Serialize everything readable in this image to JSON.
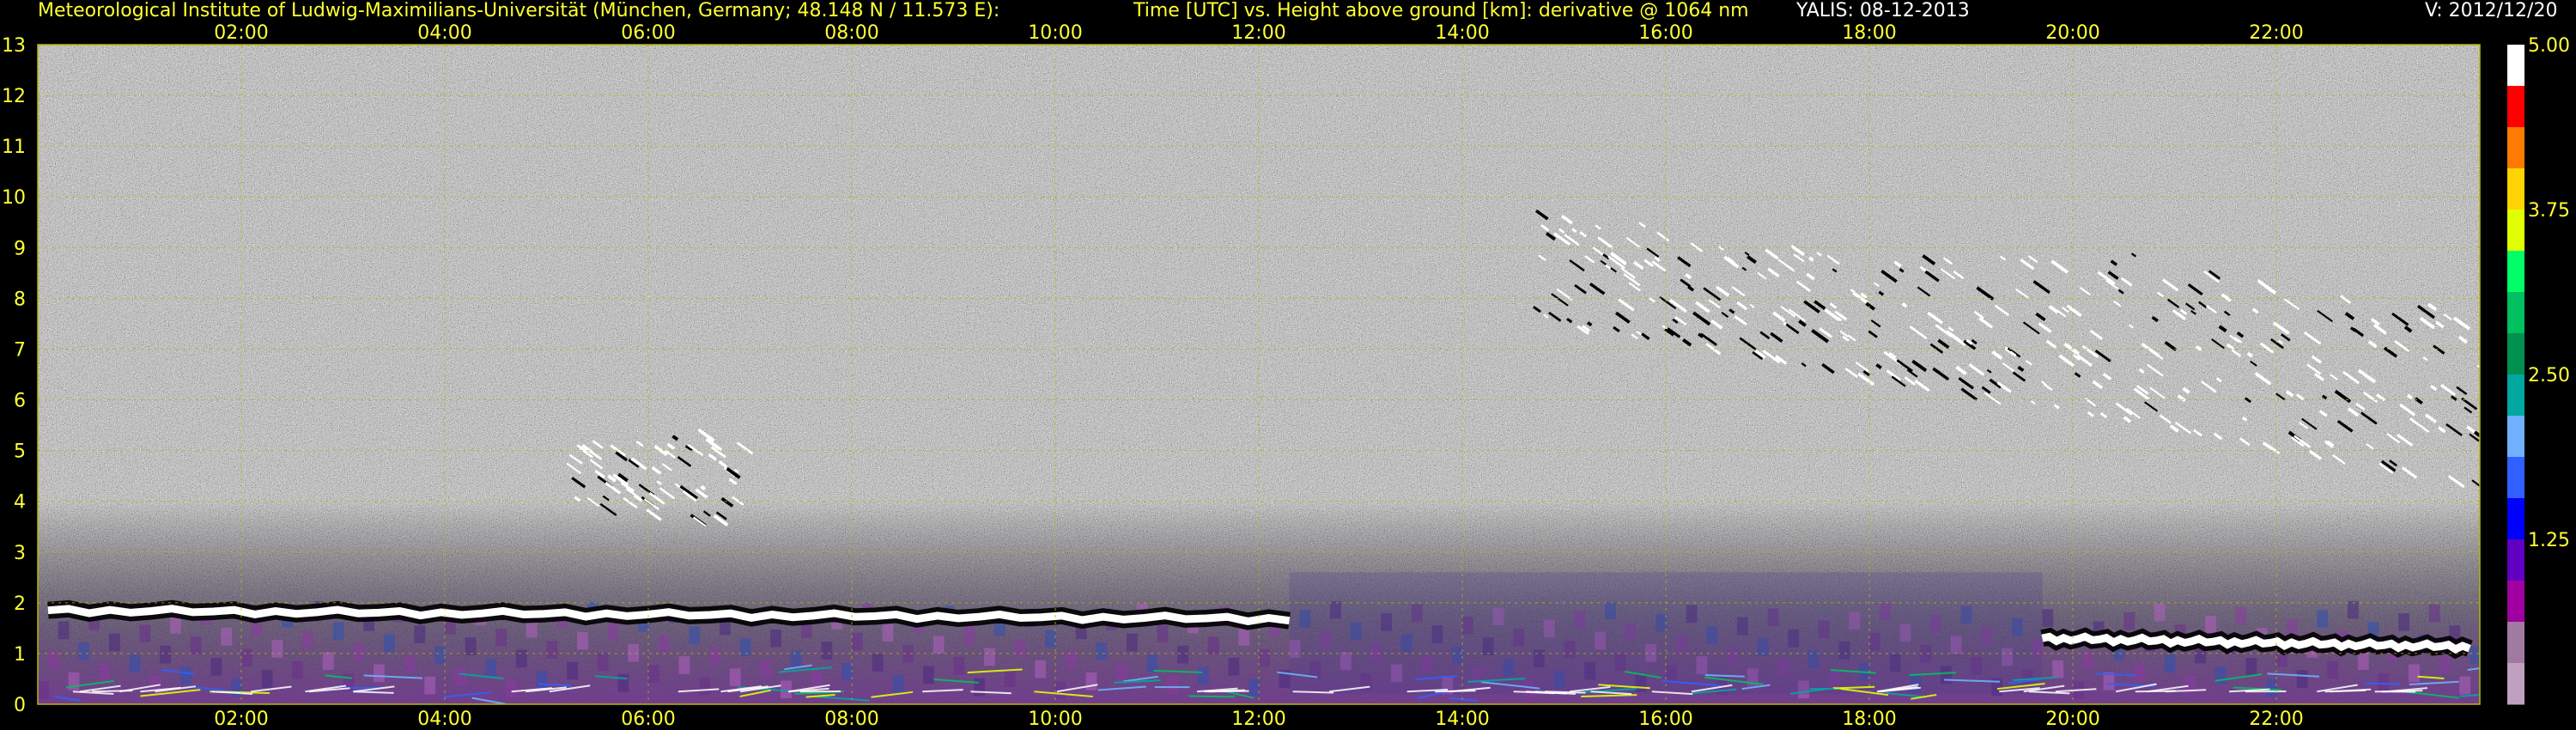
{
  "header": {
    "institute": "Meteorological Institute of Ludwig-Maximilians-Universität (München, Germany; 48.148 N / 11.573 E):",
    "description": "Time [UTC] vs. Height above ground [km]: derivative @ 1064 nm",
    "station_date": "YALIS: 08-12-2013",
    "version": "V: 2012/12/20"
  },
  "colors": {
    "background": "#000000",
    "text": "#ffff33",
    "grid": "#b8b800",
    "noise_gray": "#7a7a7a",
    "boundary_layer": "#7a3fa0"
  },
  "chart_data": {
    "type": "heatmap",
    "x": {
      "label": "Time [UTC]",
      "range": [
        "00:00",
        "24:00"
      ],
      "ticks": [
        "02:00",
        "04:00",
        "06:00",
        "08:00",
        "10:00",
        "12:00",
        "14:00",
        "16:00",
        "18:00",
        "20:00",
        "22:00"
      ],
      "tick_hours": [
        2,
        4,
        6,
        8,
        10,
        12,
        14,
        16,
        18,
        20,
        22
      ]
    },
    "y": {
      "label": "Height above ground [km]",
      "range": [
        0,
        13
      ],
      "ticks": [
        "0",
        "1",
        "2",
        "3",
        "4",
        "5",
        "6",
        "7",
        "8",
        "9",
        "10",
        "11",
        "12",
        "13"
      ]
    },
    "grid": true,
    "colorbar": {
      "placement": "right",
      "range": [
        0,
        5
      ],
      "labels": [
        "5.00",
        "3.75",
        "2.50",
        "1.25"
      ],
      "label_values": [
        5.0,
        3.75,
        2.5,
        1.25
      ],
      "colors": [
        "#ffffff",
        "#ff0000",
        "#ff7a00",
        "#ffd400",
        "#e0ff00",
        "#00ff66",
        "#00c060",
        "#009050",
        "#00a8a0",
        "#70b0ff",
        "#3060ff",
        "#0000ff",
        "#6000c0",
        "#a000a0",
        "#a07aa0",
        "#c0a0c0"
      ]
    },
    "features": [
      {
        "name": "boundary-layer-top",
        "time_start": 0.1,
        "time_end": 12.3,
        "height_km": 1.85
      },
      {
        "name": "boundary-layer-top-evening",
        "time_start": 19.7,
        "time_end": 23.9,
        "height_km": 1.3
      },
      {
        "name": "mid-level-cloud-morning",
        "time_start": 5.2,
        "time_end": 6.9,
        "height_km_min": 3.5,
        "height_km_max": 5.5
      },
      {
        "name": "cirrus-band-afternoon",
        "time_start": 14.7,
        "time_end": 24.0,
        "height_km_min": 3.8,
        "height_km_max": 10.3
      }
    ]
  }
}
